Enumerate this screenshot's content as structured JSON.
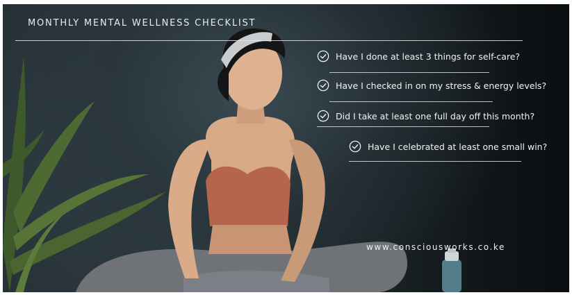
{
  "title": "MONTHLY MENTAL WELLNESS CHECKLIST",
  "checklist": [
    {
      "text": "Have I done at least 3 things for self-care?",
      "icon": "check-circle-icon"
    },
    {
      "text": "Have I checked in on my stress & energy levels?",
      "icon": "check-circle-icon"
    },
    {
      "text": "Did I take at least one full day off this month?",
      "icon": "check-circle-icon"
    },
    {
      "text": "Have I celebrated at least one small win?",
      "icon": "check-circle-icon"
    }
  ],
  "website": "www.consciousworks.co.ke",
  "colors": {
    "background": "#1b2327",
    "text": "#f1f3f4",
    "top_bar": "#0a0a0a",
    "sports_bra": "#b5644e",
    "leggings": "#6f7378",
    "plant": "#4f6b33"
  }
}
